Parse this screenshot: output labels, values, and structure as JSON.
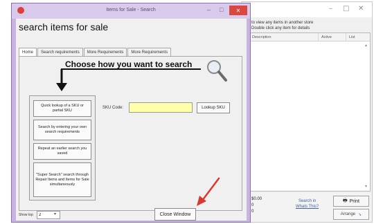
{
  "dialog": {
    "title": "Items for Sale - Search",
    "heading": "search items for sale",
    "controls": {
      "minimize": "–",
      "maximize": "□",
      "close": "✕"
    },
    "tabs": [
      {
        "label": "Home",
        "active": true
      },
      {
        "label": "Search requirements",
        "active": false
      },
      {
        "label": "More Requirements",
        "active": false
      },
      {
        "label": "More Requirements",
        "active": false
      }
    ],
    "choose_text": "Choose how you want to search",
    "options": [
      "Quick lookup of a SKU or partial SKU",
      "Search by entering your own search requirements",
      "Repeat an earlier search you saved",
      "\"Super Search\" search through Repair Items and Items for Sale simultaneously"
    ],
    "sku_label": "SKU Code:",
    "sku_value": "",
    "lookup_label": "Lookup SKU",
    "qty_label": "Show top",
    "qty_value": "2",
    "close_window_label": "Close Window"
  },
  "background_window": {
    "info_line1": "to view any items in another store",
    "info_line2": "Double click any item for details",
    "columns": [
      "Description",
      "Active",
      "List"
    ],
    "money_lines": [
      "$0.00",
      "0",
      "0"
    ],
    "lookup_text": "Search in",
    "lookup_link": "Whats This?",
    "print_label": "Print",
    "arrow_label": "Arrange"
  },
  "colors": {
    "dialog_frame": "#c8b4de",
    "sku_field": "#ffffa8",
    "close_button": "#d9473f",
    "annotation_arrow": "#d63a2f"
  },
  "icons": [
    "app-icon",
    "magnifier-icon",
    "down-arrow-icon",
    "red-arrow-icon",
    "print-icon"
  ]
}
